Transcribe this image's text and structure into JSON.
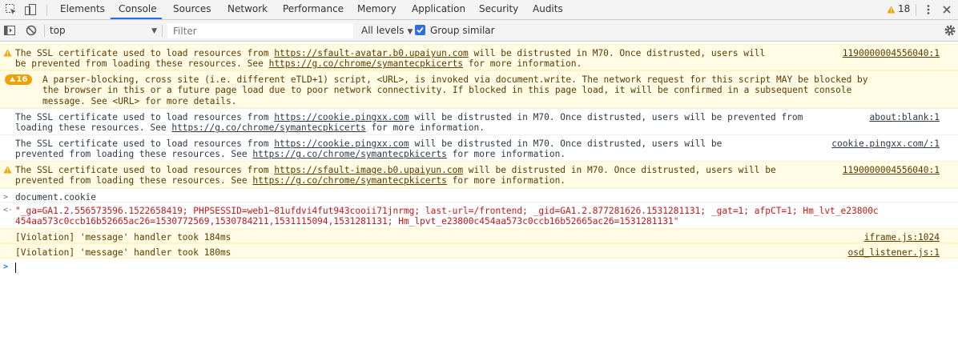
{
  "tabs": [
    {
      "label": "Elements"
    },
    {
      "label": "Console"
    },
    {
      "label": "Sources"
    },
    {
      "label": "Network"
    },
    {
      "label": "Performance"
    },
    {
      "label": "Memory"
    },
    {
      "label": "Application"
    },
    {
      "label": "Security"
    },
    {
      "label": "Audits"
    }
  ],
  "active_tab": "Console",
  "warning_count": "18",
  "toolbar": {
    "context": "top",
    "filter_placeholder": "Filter",
    "levels": "All levels",
    "group_similar": "Group similar",
    "group_similar_checked": true
  },
  "messages": [
    {
      "level": "warning",
      "line1_pre": "The SSL certificate used to load resources from ",
      "line1_link": "https://sfault-avatar.b0.upaiyun.com",
      "line1_post": " will be distrusted in M70. Once distrusted, users will",
      "line2_pre": "be prevented from loading these resources. See ",
      "line2_link": "https://g.co/chrome/symantecpkicerts",
      "line2_post": " for more information.",
      "source": "1190000004556040:1"
    },
    {
      "level": "warning",
      "badge": "16",
      "lines": [
        "A parser-blocking, cross site (i.e. different eTLD+1) script, <URL>, is invoked via document.write. The network request for this script MAY be blocked by",
        "the browser in this or a future page load due to poor network connectivity. If blocked in this page load, it will be confirmed in a subsequent console",
        "message. See <URL> for more details."
      ]
    },
    {
      "level": "info",
      "line1_pre": "The SSL certificate used to load resources from ",
      "line1_link": "https://cookie.pingxx.com",
      "line1_post": " will be distrusted in M70. Once distrusted, users will be prevented from",
      "line2_pre": "loading these resources. See ",
      "line2_link": "https://g.co/chrome/symantecpkicerts",
      "line2_post": " for more information.",
      "source": "about:blank:1"
    },
    {
      "level": "info",
      "line1_pre": "The SSL certificate used to load resources from ",
      "line1_link": "https://cookie.pingxx.com",
      "line1_post": " will be distrusted in M70. Once distrusted, users will be",
      "line2_pre": "prevented from loading these resources. See ",
      "line2_link": "https://g.co/chrome/symantecpkicerts",
      "line2_post": " for more information.",
      "source": "cookie.pingxx.com/:1"
    },
    {
      "level": "warning",
      "line1_pre": "The SSL certificate used to load resources from ",
      "line1_link": "https://sfault-image.b0.upaiyun.com",
      "line1_post": " will be distrusted in M70. Once distrusted, users will be",
      "line2_pre": "prevented from loading these resources. See ",
      "line2_link": "https://g.co/chrome/symantecpkicerts",
      "line2_post": " for more information.",
      "source": "1190000004556040:1"
    }
  ],
  "command": {
    "input": "document.cookie",
    "result_line1": "\"_ga=GA1.2.556573596.1522658419; PHPSESSID=web1~81ufdvi4fut943cooii71jnrmg; last-url=/frontend; _gid=GA1.2.877281626.1531281131; _gat=1; afpCT=1; Hm_lvt_e23800c",
    "result_line2": "454aa573c0ccb16b52665ac26=1530772569,1530784211,1531115094,1531281131; Hm_lpvt_e23800c454aa573c0ccb16b52665ac26=1531281131\""
  },
  "violations": [
    {
      "text": "[Violation] 'message' handler took 184ms",
      "source": "iframe.js:1024"
    },
    {
      "text": "[Violation] 'message' handler took 180ms",
      "source": "osd_listener.js:1"
    }
  ],
  "colors": {
    "warning_bg": "#fffbe5",
    "warning_text": "#5c3c00",
    "accent": "#1a73e8",
    "cookie_string": "#c41a16",
    "badge": "#f0a000"
  }
}
